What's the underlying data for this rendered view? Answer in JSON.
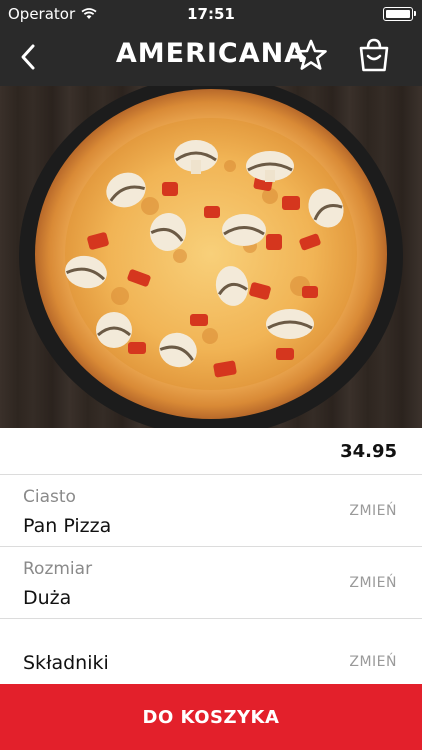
{
  "status_bar": {
    "carrier": "Operator",
    "time": "17:51"
  },
  "nav": {
    "title": "AMERICANA",
    "icons": [
      "back-chevron",
      "star-outline",
      "shopping-bag"
    ]
  },
  "product": {
    "price": "34.95"
  },
  "options": [
    {
      "label": "Ciasto",
      "value": "Pan Pizza",
      "action": "ZMIEŃ"
    },
    {
      "label": "Rozmiar",
      "value": "Duża",
      "action": "ZMIEŃ"
    },
    {
      "label": "Składniki",
      "action": "ZMIEŃ"
    }
  ],
  "cta": {
    "label": "DO KOSZYKA",
    "color": "#e3202b"
  },
  "colors": {
    "bar_background": "#2a2a2a",
    "accent": "#e3202b"
  }
}
